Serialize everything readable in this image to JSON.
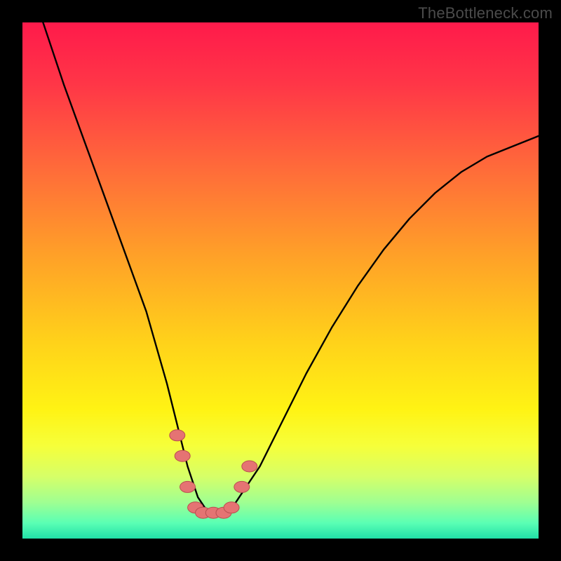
{
  "watermark": {
    "text": "TheBottleneck.com"
  },
  "colors": {
    "frame": "#000000",
    "gradient_stops": [
      {
        "offset": 0.0,
        "color": "#ff1a4b"
      },
      {
        "offset": 0.12,
        "color": "#ff3647"
      },
      {
        "offset": 0.28,
        "color": "#ff6a3a"
      },
      {
        "offset": 0.45,
        "color": "#ffa028"
      },
      {
        "offset": 0.62,
        "color": "#ffd21a"
      },
      {
        "offset": 0.75,
        "color": "#fff314"
      },
      {
        "offset": 0.82,
        "color": "#f6ff3a"
      },
      {
        "offset": 0.88,
        "color": "#d6ff68"
      },
      {
        "offset": 0.93,
        "color": "#9fff92"
      },
      {
        "offset": 0.97,
        "color": "#5affb4"
      },
      {
        "offset": 1.0,
        "color": "#21e0a8"
      }
    ],
    "curve_stroke": "#000000",
    "marker_fill": "#e57373",
    "marker_stroke": "#b94f4f"
  },
  "chart_data": {
    "type": "line",
    "title": "",
    "xlabel": "",
    "ylabel": "",
    "notes": "Bottleneck-style V-curve over a vertical performance gradient. Axes are unlabeled; values estimated from pixel positions on a 0–100 scale in both directions. Y low = green (good), Y high = red (bad). Null y = off-chart-top.",
    "xlim": [
      0,
      100
    ],
    "ylim": [
      0,
      100
    ],
    "series": [
      {
        "name": "bottleneck_curve",
        "x": [
          0,
          4,
          8,
          12,
          16,
          20,
          24,
          28,
          30,
          32,
          34,
          36,
          38,
          40,
          42,
          46,
          50,
          55,
          60,
          65,
          70,
          75,
          80,
          85,
          90,
          95,
          100
        ],
        "y": [
          null,
          100,
          88,
          77,
          66,
          55,
          44,
          30,
          22,
          14,
          8,
          5,
          5,
          5,
          8,
          14,
          22,
          32,
          41,
          49,
          56,
          62,
          67,
          71,
          74,
          76,
          78
        ]
      }
    ],
    "markers": [
      {
        "x": 30,
        "y": 20
      },
      {
        "x": 31,
        "y": 16
      },
      {
        "x": 32,
        "y": 10
      },
      {
        "x": 33.5,
        "y": 6
      },
      {
        "x": 35,
        "y": 5
      },
      {
        "x": 37,
        "y": 5
      },
      {
        "x": 39,
        "y": 5
      },
      {
        "x": 40.5,
        "y": 6
      },
      {
        "x": 42.5,
        "y": 10
      },
      {
        "x": 44,
        "y": 14
      }
    ],
    "gradient_bands_description": "Background encodes bottleneck severity from top (red, severe) to bottom (green, none), passing through orange and yellow."
  }
}
